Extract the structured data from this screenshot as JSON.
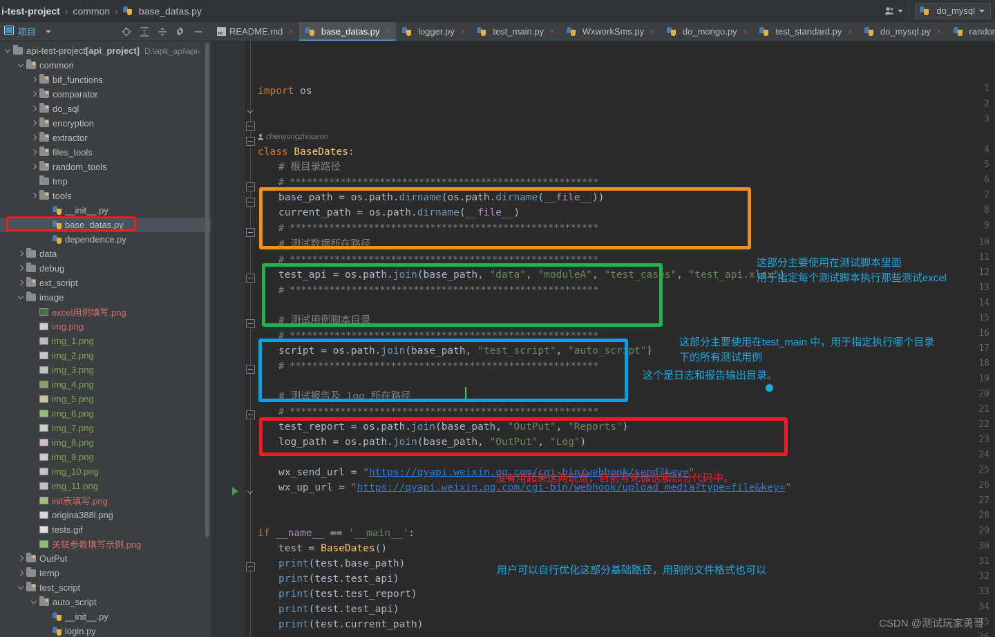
{
  "window": {
    "breadcrumb": [
      {
        "text": "i-test-project",
        "bold": true
      },
      {
        "text": "common",
        "bold": false
      },
      {
        "text": "base_datas.py",
        "bold": false,
        "icon": "python-file-icon"
      }
    ],
    "separator": "›",
    "run_config": "do_mysql",
    "people_icon": "people-icon"
  },
  "project_panel": {
    "title": "项目",
    "dropdown_icon": "chevron-down-icon",
    "tools": [
      "locate-icon",
      "expand-all-icon",
      "collapse-all-icon",
      "settings-gear-icon",
      "hide-panel-icon"
    ]
  },
  "tree": [
    {
      "depth": 0,
      "arrow": "open",
      "icon": "folder",
      "label": "api-test-project",
      "bold_extra": "[api_project]",
      "mod": "D:\\apk_api\\api-",
      "selected": false
    },
    {
      "depth": 1,
      "arrow": "open",
      "icon": "folder-src",
      "label": "common",
      "selected": false
    },
    {
      "depth": 2,
      "arrow": "closed",
      "icon": "folder-src",
      "label": "bif_functions",
      "selected": false
    },
    {
      "depth": 2,
      "arrow": "closed",
      "icon": "folder-src",
      "label": "comparator",
      "selected": false
    },
    {
      "depth": 2,
      "arrow": "closed",
      "icon": "folder-src",
      "label": "do_sql",
      "selected": false
    },
    {
      "depth": 2,
      "arrow": "closed",
      "icon": "folder-src",
      "label": "encryption",
      "selected": false
    },
    {
      "depth": 2,
      "arrow": "closed",
      "icon": "folder-src",
      "label": "extractor",
      "selected": false
    },
    {
      "depth": 2,
      "arrow": "closed",
      "icon": "folder-src",
      "label": "files_tools",
      "selected": false
    },
    {
      "depth": 2,
      "arrow": "closed",
      "icon": "folder-src",
      "label": "random_tools",
      "selected": false
    },
    {
      "depth": 2,
      "arrow": "none",
      "icon": "folder",
      "label": "tmp",
      "selected": false
    },
    {
      "depth": 2,
      "arrow": "closed",
      "icon": "folder-src",
      "label": "tools",
      "selected": false
    },
    {
      "depth": 3,
      "arrow": "none",
      "icon": "python",
      "label": "__init__.py",
      "selected": false
    },
    {
      "depth": 3,
      "arrow": "none",
      "icon": "python",
      "label": "base_datas.py",
      "selected": true
    },
    {
      "depth": 3,
      "arrow": "none",
      "icon": "python",
      "label": "dependence.py",
      "selected": false
    },
    {
      "depth": 1,
      "arrow": "closed",
      "icon": "folder",
      "label": "data",
      "selected": false
    },
    {
      "depth": 1,
      "arrow": "closed",
      "icon": "folder",
      "label": "debug",
      "selected": false
    },
    {
      "depth": 1,
      "arrow": "closed",
      "icon": "folder-src",
      "label": "ext_script",
      "selected": false
    },
    {
      "depth": 1,
      "arrow": "open",
      "icon": "folder",
      "label": "image",
      "selected": false
    },
    {
      "depth": 2,
      "arrow": "none",
      "icon": "image",
      "label": "excel用例填写.png",
      "color": "#d16c6c",
      "thumb": "#4a6a4a"
    },
    {
      "depth": 2,
      "arrow": "none",
      "icon": "image",
      "label": "img.png",
      "color": "#d16c6c",
      "thumb": "#cfcfcf"
    },
    {
      "depth": 2,
      "arrow": "none",
      "icon": "image",
      "label": "img_1.png",
      "color": "#7aa84f",
      "thumb": "#bcbcbc"
    },
    {
      "depth": 2,
      "arrow": "none",
      "icon": "image",
      "label": "img_2.png",
      "color": "#7aa84f",
      "thumb": "#c9c9c9"
    },
    {
      "depth": 2,
      "arrow": "none",
      "icon": "image",
      "label": "img_3.png",
      "color": "#7aa84f",
      "thumb": "#c3c3c3"
    },
    {
      "depth": 2,
      "arrow": "none",
      "icon": "image",
      "label": "img_4.png",
      "color": "#7aa84f",
      "thumb": "#8aa06a"
    },
    {
      "depth": 2,
      "arrow": "none",
      "icon": "image",
      "label": "img_5.png",
      "color": "#7aa84f",
      "thumb": "#c8c49a"
    },
    {
      "depth": 2,
      "arrow": "none",
      "icon": "image",
      "label": "img_6.png",
      "color": "#7aa84f",
      "thumb": "#8fbf6a"
    },
    {
      "depth": 2,
      "arrow": "none",
      "icon": "image",
      "label": "img_7.png",
      "color": "#7aa84f",
      "thumb": "#cbcbcb"
    },
    {
      "depth": 2,
      "arrow": "none",
      "icon": "image",
      "label": "img_8.png",
      "color": "#7aa84f",
      "thumb": "#d0c0c0"
    },
    {
      "depth": 2,
      "arrow": "none",
      "icon": "image",
      "label": "img_9.png",
      "color": "#7aa84f",
      "thumb": "#cdcdcd"
    },
    {
      "depth": 2,
      "arrow": "none",
      "icon": "image",
      "label": "img_10.png",
      "color": "#7aa84f",
      "thumb": "#c6c6c6"
    },
    {
      "depth": 2,
      "arrow": "none",
      "icon": "image",
      "label": "img_11.png",
      "color": "#7aa84f",
      "thumb": "#c1c1c1"
    },
    {
      "depth": 2,
      "arrow": "none",
      "icon": "image",
      "label": "init表填写.png",
      "color": "#d16c6c",
      "thumb": "#9fbf7a"
    },
    {
      "depth": 2,
      "arrow": "none",
      "icon": "image",
      "label": "origina388l.png",
      "color": "#bbbbbb",
      "thumb": "#d8d8d8"
    },
    {
      "depth": 2,
      "arrow": "none",
      "icon": "image",
      "label": "tests.gif",
      "color": "#bbbbbb",
      "thumb": "#dedede"
    },
    {
      "depth": 2,
      "arrow": "none",
      "icon": "image",
      "label": "关联参数填写示例.png",
      "color": "#d16c6c",
      "thumb": "#8fbf6a"
    },
    {
      "depth": 1,
      "arrow": "closed",
      "icon": "folder-src",
      "label": "OutPut",
      "selected": false
    },
    {
      "depth": 1,
      "arrow": "closed",
      "icon": "folder",
      "label": "temp",
      "selected": false
    },
    {
      "depth": 1,
      "arrow": "open",
      "icon": "folder-src",
      "label": "test_script",
      "selected": false
    },
    {
      "depth": 2,
      "arrow": "open",
      "icon": "folder-src",
      "label": "auto_script",
      "selected": false
    },
    {
      "depth": 3,
      "arrow": "none",
      "icon": "python",
      "label": "__init__.py",
      "selected": false
    },
    {
      "depth": 3,
      "arrow": "none",
      "icon": "python",
      "label": "login.py",
      "selected": false
    }
  ],
  "tabs": [
    {
      "label": "README.md",
      "icon": "markdown-file-icon",
      "active": false,
      "close": "×"
    },
    {
      "label": "base_datas.py",
      "icon": "python-file-icon",
      "active": true,
      "close": "×"
    },
    {
      "label": "logger.py",
      "icon": "python-file-icon",
      "active": false,
      "close": "×"
    },
    {
      "label": "test_main.py",
      "icon": "python-file-icon",
      "active": false,
      "close": "×"
    },
    {
      "label": "WxworkSms.py",
      "icon": "python-file-icon",
      "active": false,
      "close": "×"
    },
    {
      "label": "do_mongo.py",
      "icon": "python-file-icon",
      "active": false,
      "close": "×"
    },
    {
      "label": "test_standard.py",
      "icon": "python-file-icon",
      "active": false,
      "close": "×"
    },
    {
      "label": "do_mysql.py",
      "icon": "python-file-icon",
      "active": false,
      "close": "×"
    },
    {
      "label": "random_tools.p",
      "icon": "python-file-icon",
      "active": false,
      "close": ""
    }
  ],
  "editor": {
    "vcs_author": "chenyongzhiaaron",
    "line_numbers": [
      1,
      2,
      3,
      4,
      5,
      6,
      7,
      8,
      9,
      10,
      11,
      12,
      13,
      14,
      15,
      16,
      17,
      18,
      19,
      20,
      21,
      22,
      23,
      24,
      25,
      26,
      27,
      28,
      29,
      30,
      31,
      32,
      33,
      34,
      35,
      36
    ],
    "code": {
      "l1_import": "import",
      "l1_mod": " os",
      "l4_class": "class",
      "l4_name": " BaseDates",
      "l4_colon": ":",
      "l5": "# 根目录路径",
      "l6": "# *******************************************************",
      "l7": "base_path = os.path.dirname(os.path.dirname(__file__))",
      "l8": "current_path = os.path.dirname(__file__)",
      "l9": "# *******************************************************",
      "l10": "# 测试数据所在路径",
      "l11": "# *******************************************************",
      "l12": "test_api = os.path.join(base_path, \"data\", \"moduleA\", \"test_cases\", \"test_api.xlsx\")",
      "l13": "# *******************************************************",
      "l15": "# 测试用例脚本目录",
      "l16": "# *******************************************************",
      "l17": "script = os.path.join(base_path, \"test_script\", \"auto_script\")",
      "l18": "# *******************************************************",
      "l20": "# 测试报告及 log 所在路径",
      "l21": "# *******************************************************",
      "l22": "test_report = os.path.join(base_path, \"OutPut\", \"Reports\")",
      "l23": "log_path = os.path.join(base_path, \"OutPut\", \"Log\")",
      "l25_var": "wx_send_url = ",
      "l25_url": "https://qyapi.weixin.qq.com/cgi-bin/webhook/send?key=",
      "l26_var": "wx_up_url = ",
      "l26_url": "https://qyapi.weixin.qq.com/cgi-bin/webhook/upload_media?type=file&key=",
      "l29": "if __name__ == '__main__':",
      "l30": "test = BaseDates()",
      "l31": "print(test.base_path)",
      "l32": "print(test.test_api)",
      "l33": "print(test.test_report)",
      "l34": "print(test.test_api)",
      "l35": "print(test.current_path)"
    }
  },
  "highlights": [
    {
      "name": "orange-box",
      "color": "#f2901f",
      "lines": "10-13"
    },
    {
      "name": "green-box",
      "color": "#24b24b",
      "lines": "15-18"
    },
    {
      "name": "blue-box",
      "color": "#00a2e8",
      "lines": "20-23"
    },
    {
      "name": "red-box",
      "color": "#ee1c24",
      "lines": "25-26"
    },
    {
      "name": "tree-red-box",
      "color": "#ee1c24",
      "target": "base_datas.py"
    }
  ],
  "annotations": [
    {
      "id": "a1",
      "color": "#1ea7e1",
      "text": "这部分主要使用在测试脚本里面\n用于指定每个测试脚本执行那些测试excel"
    },
    {
      "id": "a2",
      "color": "#1ea7e1",
      "text": "这部分主要使用在test_main 中，用于指定执行哪个目录\n下的所有测试用例"
    },
    {
      "id": "a3",
      "color": "#1ea7e1",
      "text": "这个是日志和报告输出目录。"
    },
    {
      "id": "a4",
      "color": "#e8232c",
      "text": "没有用起来这两玩意，目前写死微信那部分代码中。"
    },
    {
      "id": "a5",
      "color": "#1ea7e1",
      "text": "用户可以自行优化这部分基础路径，用别的文件格式也可以"
    }
  ],
  "watermark": "CSDN @测试玩家勇哥"
}
